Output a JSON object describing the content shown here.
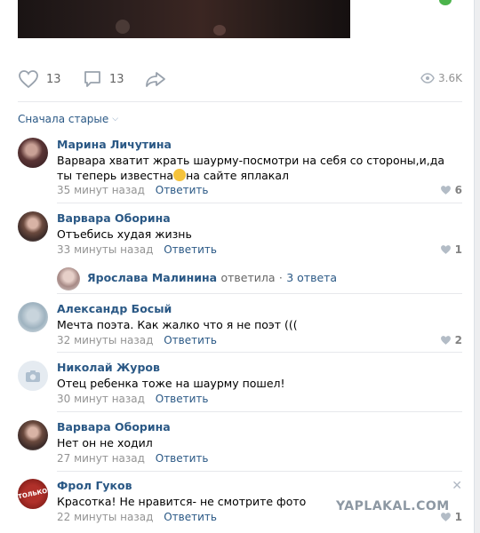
{
  "post": {
    "likes": "13",
    "comments": "13",
    "views": "3.6K"
  },
  "sort_label": "Сначала старые",
  "reply_label": "Ответить",
  "comments": [
    {
      "author": "Марина Личутина",
      "text_part1": "Варвара хватит жрать шаурму-посмотри на себя со стороны,и,да ты теперь известна",
      "text_part2": "на сайте яплакал",
      "time": "35 минут назад",
      "likes": "6"
    },
    {
      "author": "Варвара Оборина",
      "text": "Отъебись худая жизнь",
      "time": "33 минуты назад",
      "likes": "1"
    },
    {
      "author": "Александр Босый",
      "text": "Мечта поэта. Как жалко что я не поэт (((",
      "time": "32 минуты назад",
      "likes": "2"
    },
    {
      "author": "Николай Журов",
      "text": "Отец ребенка тоже на шаурму пошел!",
      "time": "30 минут назад"
    },
    {
      "author": "Варвара Оборина",
      "text": "Нет он не ходил",
      "time": "27 минут назад"
    },
    {
      "author": "Фрол Гуков",
      "text": "Красотка! Не нравится- не смотрите фото",
      "time": "22 минуты назад",
      "likes": "1"
    }
  ],
  "thread": {
    "author": "Ярослава Малинина",
    "action": "ответила",
    "replies": "3 ответа"
  },
  "avatar_badge_text": "ТОЛЬКО",
  "watermark": "YAPLAKAL.COM"
}
